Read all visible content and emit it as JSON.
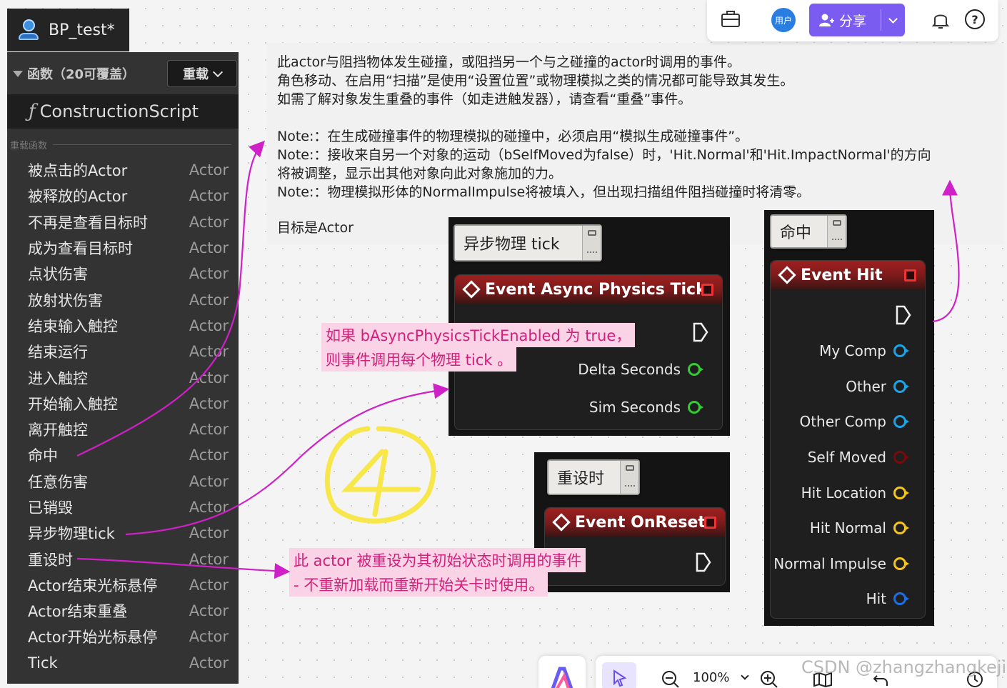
{
  "app": {
    "tab_title": "BP_test*"
  },
  "panel": {
    "functions_header": "函数（20可覆盖）",
    "override_label": "重载",
    "construction_script": "ConstructionScript",
    "section_label": "重载函数",
    "items": [
      {
        "name": "被点击的Actor",
        "type": "Actor"
      },
      {
        "name": "被释放的Actor",
        "type": "Actor"
      },
      {
        "name": "不再是查看目标时",
        "type": "Actor"
      },
      {
        "name": "成为查看目标时",
        "type": "Actor"
      },
      {
        "name": "点状伤害",
        "type": "Actor"
      },
      {
        "name": "放射状伤害",
        "type": "Actor"
      },
      {
        "name": "结束输入触控",
        "type": "Actor"
      },
      {
        "name": "结束运行",
        "type": "Actor"
      },
      {
        "name": "进入触控",
        "type": "Actor"
      },
      {
        "name": "开始输入触控",
        "type": "Actor"
      },
      {
        "name": "离开触控",
        "type": "Actor"
      },
      {
        "name": "命中",
        "type": "Actor"
      },
      {
        "name": "任意伤害",
        "type": "Actor"
      },
      {
        "name": "已销毁",
        "type": "Actor"
      },
      {
        "name": "异步物理tick",
        "type": "Actor"
      },
      {
        "name": "重设时",
        "type": "Actor"
      },
      {
        "name": "Actor结束光标悬停",
        "type": "Actor"
      },
      {
        "name": "Actor结束重叠",
        "type": "Actor"
      },
      {
        "name": "Actor开始光标悬停",
        "type": "Actor"
      },
      {
        "name": "Tick",
        "type": "Actor"
      }
    ]
  },
  "tooltip": {
    "lines": [
      "此actor与阻挡物体发生碰撞，或阻挡另一个与之碰撞的actor时调用的事件。",
      "角色移动、在启用“扫描”是使用“设置位置”或物理模拟之类的情况都可能导致其发生。",
      "如需了解对象发生重叠的事件（如走进触发器），请查看“重叠”事件。",
      "Note:：在生成碰撞事件的物理模拟的碰撞中，必须启用“模拟生成碰撞事件”。",
      "Note:：接收来自另一个对象的运动（bSelfMoved为false）时，'Hit.Normal'和'Hit.ImpactNormal'的方向",
      "将被调整，显示出其他对象向此对象施加的力。",
      "Note:：物理模拟形体的NormalImpulse将被填入，但出现扫描组件阻挡碰撞时将清零。",
      "目标是Actor"
    ]
  },
  "nodes": {
    "async": {
      "badge": "异步物理 tick",
      "title": "Event Async Physics Tick",
      "pins": [
        "Delta Seconds",
        "Sim Seconds"
      ]
    },
    "reset": {
      "badge": "重设时",
      "title": "Event OnReset"
    },
    "hit": {
      "badge": "命中",
      "title": "Event Hit",
      "pins": [
        "My Comp",
        "Other",
        "Other Comp",
        "Self Moved",
        "Hit Location",
        "Hit Normal",
        "Normal Impulse",
        "Hit"
      ]
    }
  },
  "annotations": {
    "async_1": "如果 bAsyncPhysicsTickEnabled 为 true，",
    "async_2": "则事件调用每个物理 tick 。",
    "reset_1": "此 actor 被重设为其初始状态时调用的事件",
    "reset_2": "- 不重新加载而重新开始关卡时使用。"
  },
  "toolbar": {
    "user_label": "用户",
    "share_label": "分享",
    "zoom_level": "100%"
  },
  "watermark": "CSDN @zhangzhangkeji",
  "colors": {
    "accent": "#7a5cf0",
    "annotation_pink": "#d0207a",
    "annotation_bg": "#fbd3e6",
    "event_red": "#a02020",
    "pin_blue": "#1aa3e8",
    "pin_green": "#33cc33",
    "pin_yellow": "#f5c518",
    "pin_darkred": "#7a0a0a",
    "circle_yellow": "#f7e74a"
  }
}
